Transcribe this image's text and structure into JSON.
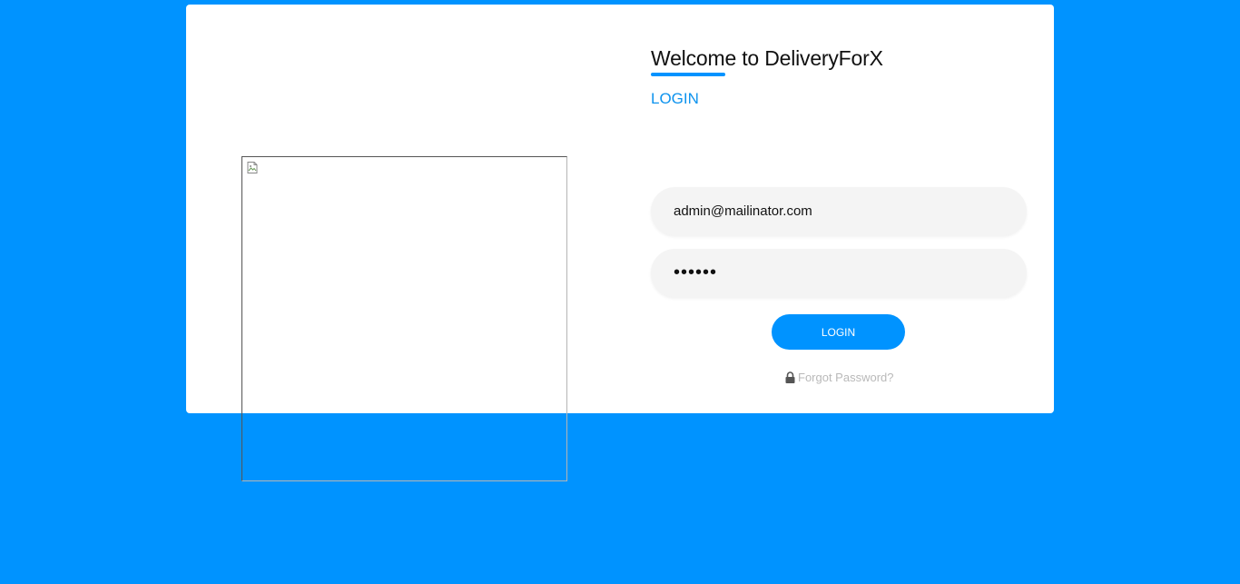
{
  "header": {
    "title": "Welcome to DeliveryForX",
    "subtitle": "LOGIN"
  },
  "form": {
    "email_value": "admin@mailinator.com",
    "password_value": "••••••",
    "submit_label": "LOGIN",
    "forgot_label": "Forgot Password?"
  },
  "icons": {
    "broken_image": "broken-image-icon",
    "lock": "lock-icon"
  },
  "colors": {
    "background": "#0093ff",
    "accent": "#0093ff",
    "card": "#ffffff",
    "field_bg": "#f4f4f4",
    "muted_text": "#b9b9b9"
  }
}
